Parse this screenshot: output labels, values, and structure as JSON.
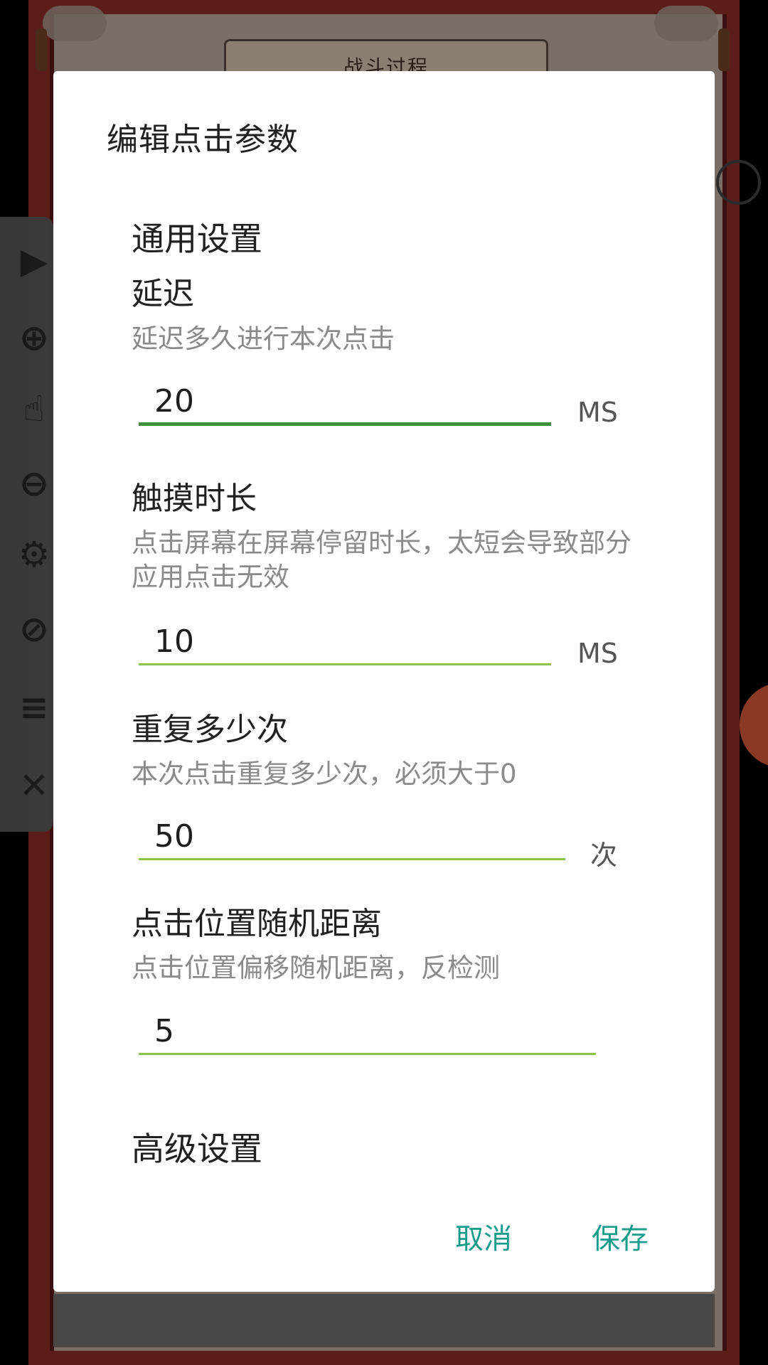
{
  "background": {
    "title": "战斗过程"
  },
  "dialog": {
    "title": "编辑点击参数",
    "general_section": "通用设置",
    "advanced_section": "高级设置",
    "delay": {
      "title": "延迟",
      "description": "延迟多久进行本次点击",
      "value": "20",
      "unit": "MS"
    },
    "touch_duration": {
      "title": "触摸时长",
      "description": "点击屏幕在屏幕停留时长，太短会导致部分应用点击无效",
      "value": "10",
      "unit": "MS"
    },
    "repeat": {
      "title": "重复多少次",
      "description": "本次点击重复多少次，必须大于0",
      "value": "50",
      "unit": "次"
    },
    "random_distance": {
      "title": "点击位置随机距离",
      "description": "点击位置偏移随机距离，反检测",
      "value": "5"
    },
    "cancel_label": "取消",
    "save_label": "保存"
  },
  "colors": {
    "accent": "#1a9c8c",
    "input_focused": "#3f8f3f",
    "input_underline": "#8bc34a"
  }
}
